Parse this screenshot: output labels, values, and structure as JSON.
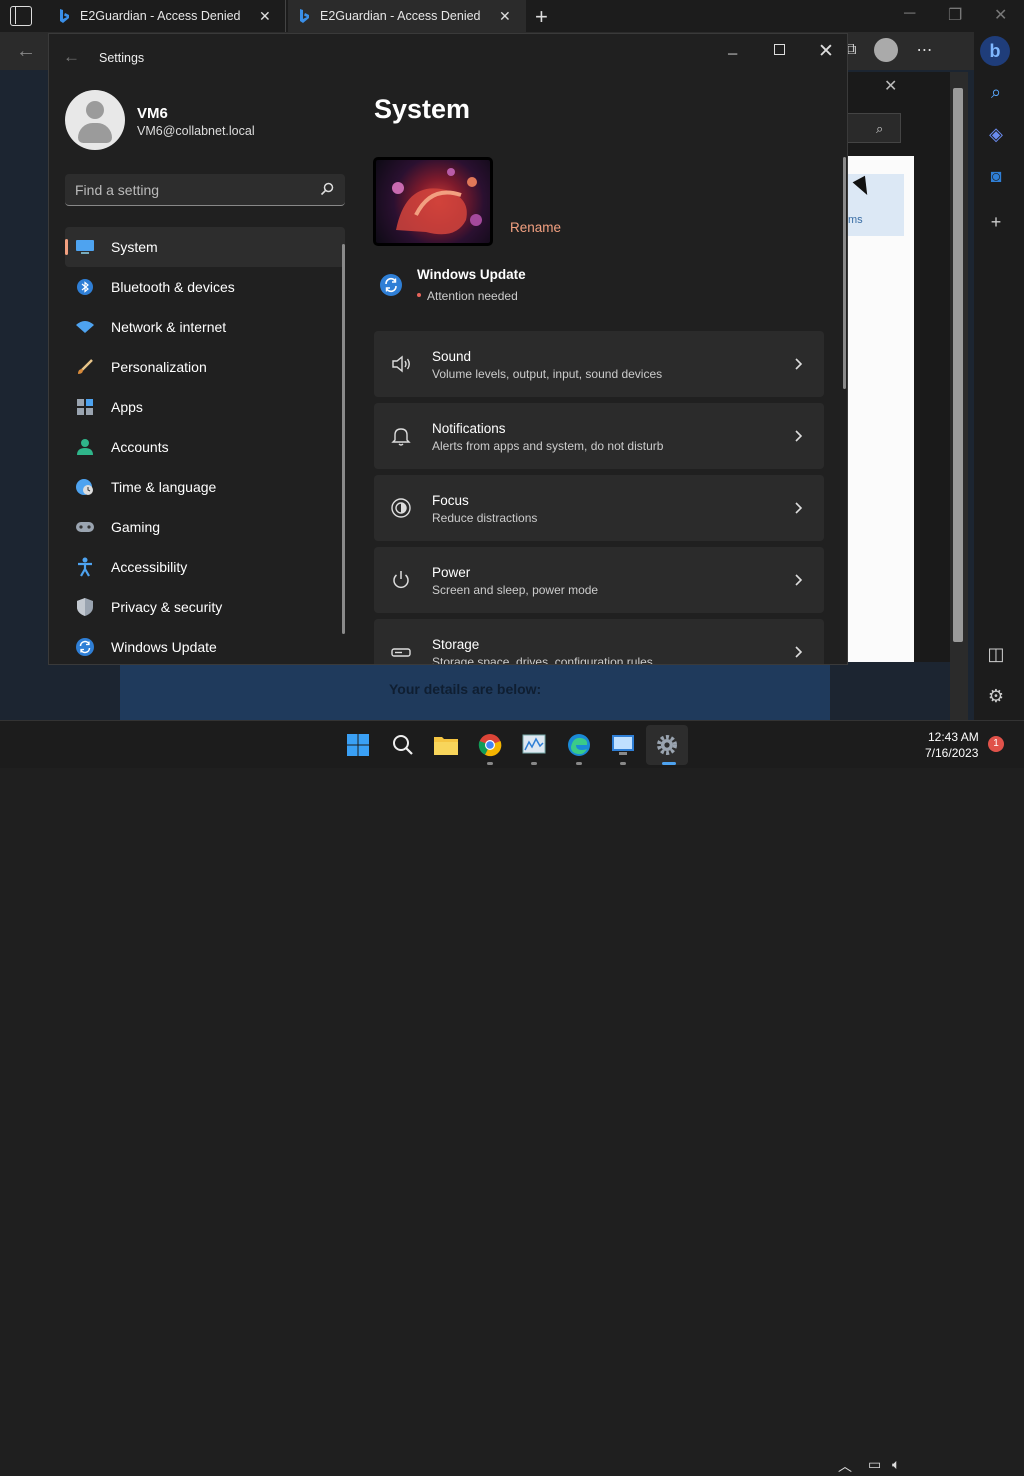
{
  "browser": {
    "tabs": [
      {
        "label": "E2Guardian - Access Denied"
      },
      {
        "label": "E2Guardian - Access Denied"
      }
    ],
    "new_tab_symbol": "+",
    "page_footer_text": "Your details are below:",
    "behind_card_text": "ms"
  },
  "settings": {
    "window_title": "Settings",
    "user": {
      "name": "VM6",
      "email": "VM6@collabnet.local"
    },
    "search": {
      "placeholder": "Find a setting"
    },
    "nav": [
      {
        "label": "System",
        "icon": "monitor-icon"
      },
      {
        "label": "Bluetooth & devices",
        "icon": "bluetooth-icon"
      },
      {
        "label": "Network & internet",
        "icon": "wifi-icon"
      },
      {
        "label": "Personalization",
        "icon": "brush-icon"
      },
      {
        "label": "Apps",
        "icon": "apps-icon"
      },
      {
        "label": "Accounts",
        "icon": "person-icon"
      },
      {
        "label": "Time & language",
        "icon": "globe-clock-icon"
      },
      {
        "label": "Gaming",
        "icon": "gamepad-icon"
      },
      {
        "label": "Accessibility",
        "icon": "accessibility-icon"
      },
      {
        "label": "Privacy & security",
        "icon": "shield-icon"
      },
      {
        "label": "Windows Update",
        "icon": "update-icon"
      }
    ],
    "active_nav": "System",
    "page_title": "System",
    "rename_label": "Rename",
    "windows_update": {
      "title": "Windows Update",
      "status": "Attention needed"
    },
    "cards": [
      {
        "title": "Sound",
        "desc": "Volume levels, output, input, sound devices",
        "icon": "speaker-icon"
      },
      {
        "title": "Notifications",
        "desc": "Alerts from apps and system, do not disturb",
        "icon": "bell-icon"
      },
      {
        "title": "Focus",
        "desc": "Reduce distractions",
        "icon": "focus-icon"
      },
      {
        "title": "Power",
        "desc": "Screen and sleep, power mode",
        "icon": "power-icon"
      },
      {
        "title": "Storage",
        "desc": "Storage space, drives, configuration rules",
        "icon": "storage-icon"
      }
    ]
  },
  "taskbar": {
    "time": "12:43 AM",
    "date": "7/16/2023",
    "notification_count": "1"
  },
  "colors": {
    "accent": "#f2a080",
    "windows_blue": "#2f7fd6"
  }
}
